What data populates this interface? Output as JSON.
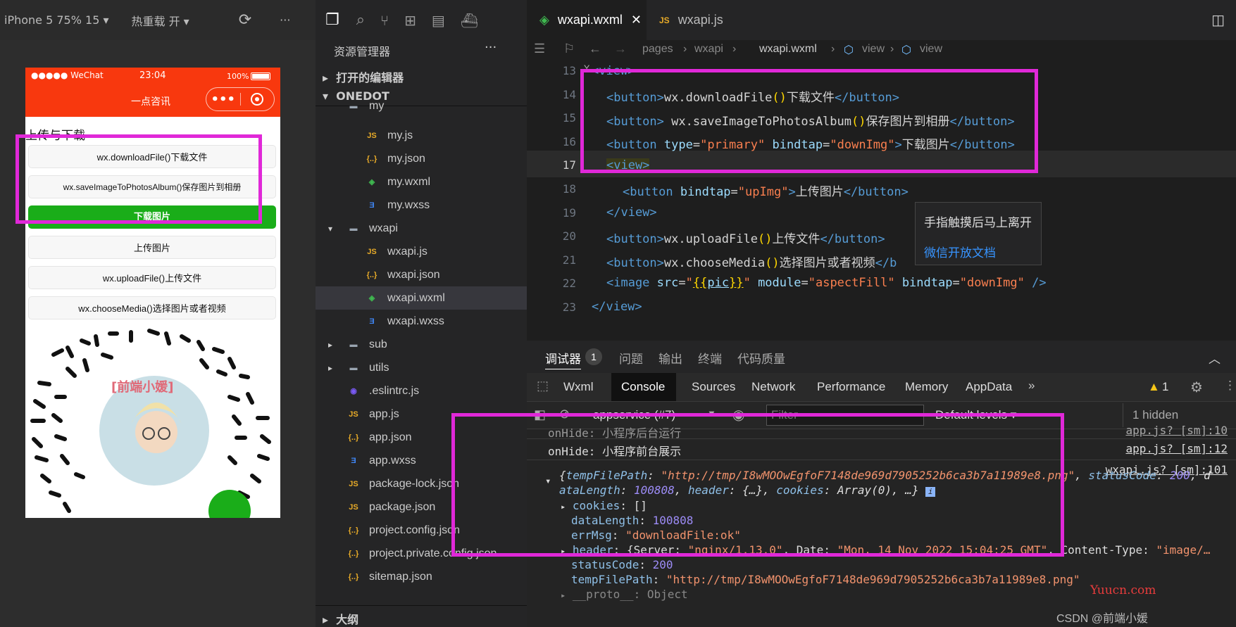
{
  "simulator": {
    "device": "iPhone 5 75% 15",
    "hot_reload": "热重载 开",
    "signal": "●●●●● WeChat",
    "time": "23:04",
    "battery": "100%",
    "nav_title": "一点咨讯",
    "section_title": "上传与下载",
    "buttons": [
      "wx.downloadFile()下载文件",
      "wx.saveImageToPhotosAlbum()保存图片到相册",
      "下载图片",
      "上传图片",
      "wx.uploadFile()上传文件",
      "wx.chooseMedia()选择图片或者视频"
    ],
    "qr_text": "[前端小媛]"
  },
  "explorer": {
    "title": "资源管理器",
    "open_editors": "打开的编辑器",
    "project": "ONEDOT",
    "outline": "大纲",
    "items": [
      {
        "name": "my",
        "icon": "folder"
      },
      {
        "name": "my.js",
        "icon": "JS"
      },
      {
        "name": "my.json",
        "icon": "{..}"
      },
      {
        "name": "my.wxml",
        "icon": "<>"
      },
      {
        "name": "my.wxss",
        "icon": "3"
      },
      {
        "name": "wxapi",
        "icon": "folder"
      },
      {
        "name": "wxapi.js",
        "icon": "JS"
      },
      {
        "name": "wxapi.json",
        "icon": "{..}"
      },
      {
        "name": "wxapi.wxml",
        "icon": "<>"
      },
      {
        "name": "wxapi.wxss",
        "icon": "3"
      },
      {
        "name": "sub",
        "icon": "folder"
      },
      {
        "name": "utils",
        "icon": "folder"
      },
      {
        "name": ".eslintrc.js",
        "icon": "O"
      },
      {
        "name": "app.js",
        "icon": "JS"
      },
      {
        "name": "app.json",
        "icon": "{..}"
      },
      {
        "name": "app.wxss",
        "icon": "3"
      },
      {
        "name": "package-lock.json",
        "icon": "JS"
      },
      {
        "name": "package.json",
        "icon": "JS"
      },
      {
        "name": "project.config.json",
        "icon": "{..}"
      },
      {
        "name": "project.private.config.json",
        "icon": "{..}"
      },
      {
        "name": "sitemap.json",
        "icon": "{..}"
      }
    ]
  },
  "editor": {
    "tab_active": "wxapi.wxml",
    "tab_other": "wxapi.js",
    "breadcrumb": [
      "pages",
      "wxapi",
      "wxapi.wxml",
      "view",
      "view"
    ],
    "line_numbers": [
      "13",
      "14",
      "15",
      "16",
      "17",
      "18",
      "19",
      "20",
      "21",
      "22",
      "23"
    ],
    "tooltip": {
      "title": "手指触摸后马上离开",
      "link": "微信开放文档"
    }
  },
  "panel": {
    "tabs": [
      "调试器",
      "问题",
      "输出",
      "终端",
      "代码质量"
    ],
    "badge": "1",
    "devtools_tabs": [
      "Wxml",
      "Console",
      "Sources",
      "Network",
      "Performance",
      "Memory",
      "AppData"
    ],
    "warnings": "1",
    "context": "appservice (#7)",
    "filter_placeholder": "Filter",
    "levels": "Default levels",
    "hidden": "1 hidden"
  },
  "console": {
    "onhide_cut": "onHide: 小程序后台运行",
    "onhide_cut_src": "app.js? [sm]:10",
    "onhide": "onHide: 小程序前台展示",
    "onhide_src": "app.js? [sm]:12",
    "obj_src": "wxapi.js? [sm]:101",
    "temp_path": "http://tmp/I8wMOOwEgfoF7148de969d7905252b6ca3b7a11989e8.png",
    "data_length": "100808",
    "err_msg": "downloadFile:ok",
    "server": "nginx/1.13.0",
    "date": "Mon, 14 Nov 2022 15:04:25 GMT",
    "status_code": "200"
  },
  "watermark": {
    "site": "Yuucn.com",
    "csdn": "CSDN @前端小媛"
  },
  "colors": {
    "highlight": "#e028d8",
    "wechat_red": "#f8380e",
    "primary_green": "#1aad19"
  }
}
